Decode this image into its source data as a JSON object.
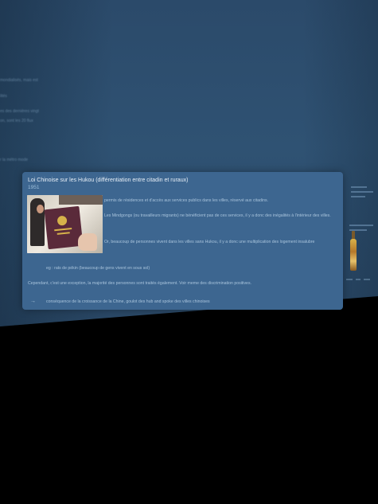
{
  "note": {
    "title": "Loi Chinoise sur les Hukou (différentiation entre citadin et ruraux)",
    "year": "1951",
    "image_alt": "hukou-booklet-photo",
    "paragraphs": [
      "permis de résidences et d'accès aux services publics dans les villes, réservé aux citadins.",
      "Les Mindgongs (ou travailleurs migrants) ne bénéficient pas de ces services, il y a donc des inégalités à l'intérieur des villes.",
      "Or, beaucoup de personnes vivent dans les villes sans Hukou, il y a donc une multiplication des logement insalubre",
      "eg : rats de pékin (beaucoup de gens vivent en sous sol)",
      "Cependant, c'est une exception, la majorité des personnes sont traités également. Voir meme des discrimination positives.",
      "conséquence de la croissance de la Chine, goulot des hub and spoke des villes chinoises"
    ],
    "arrow": "→",
    "accent_color": "#3d6690"
  },
  "background": {
    "blurred_lines": [
      "mondialisés, mais est",
      "lités",
      "es des dernières vingt",
      "on, sont les 20 flux",
      "r la métro mode"
    ]
  }
}
